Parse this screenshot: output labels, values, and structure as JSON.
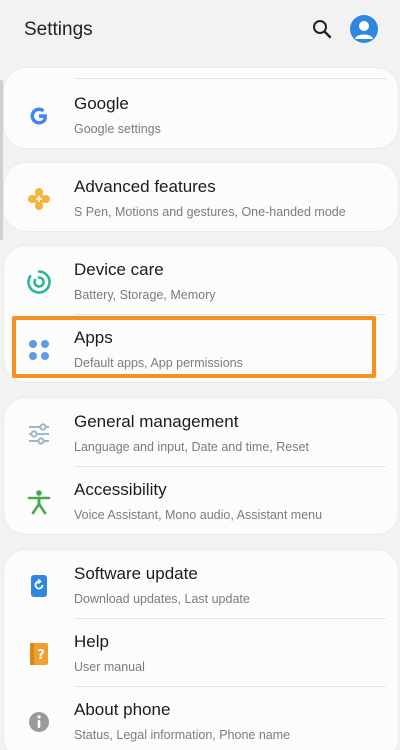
{
  "header": {
    "title": "Settings"
  },
  "icons": {
    "search": "search-icon",
    "avatar": "profile-avatar-icon"
  },
  "items": {
    "google": {
      "name": "Google",
      "sub": "Google settings",
      "icon": "google-icon"
    },
    "advanced": {
      "name": "Advanced features",
      "sub": "S Pen, Motions and gestures, One-handed mode",
      "icon": "puzzle-icon"
    },
    "device_care": {
      "name": "Device care",
      "sub": "Battery, Storage, Memory",
      "icon": "device-care-icon"
    },
    "apps": {
      "name": "Apps",
      "sub": "Default apps, App permissions",
      "icon": "apps-grid-icon"
    },
    "general": {
      "name": "General management",
      "sub": "Language and input, Date and time, Reset",
      "icon": "sliders-icon"
    },
    "accessibility": {
      "name": "Accessibility",
      "sub": "Voice Assistant, Mono audio, Assistant menu",
      "icon": "accessibility-icon"
    },
    "software": {
      "name": "Software update",
      "sub": "Download updates, Last update",
      "icon": "software-update-icon"
    },
    "help": {
      "name": "Help",
      "sub": "User manual",
      "icon": "help-icon"
    },
    "about": {
      "name": "About phone",
      "sub": "Status, Legal information, Phone name",
      "icon": "info-icon"
    }
  },
  "colors": {
    "highlight": "#f7901e",
    "google_blue": "#4285f4",
    "advanced_orange": "#f5b433",
    "device_care_teal": "#2fb39a",
    "apps_blue": "#5c9be8",
    "general_gray": "#9bb6c4",
    "accessibility_green": "#4aa84a",
    "software_blue": "#2f86e3",
    "help_orange": "#f0a030",
    "about_gray": "#9a9a9a"
  }
}
